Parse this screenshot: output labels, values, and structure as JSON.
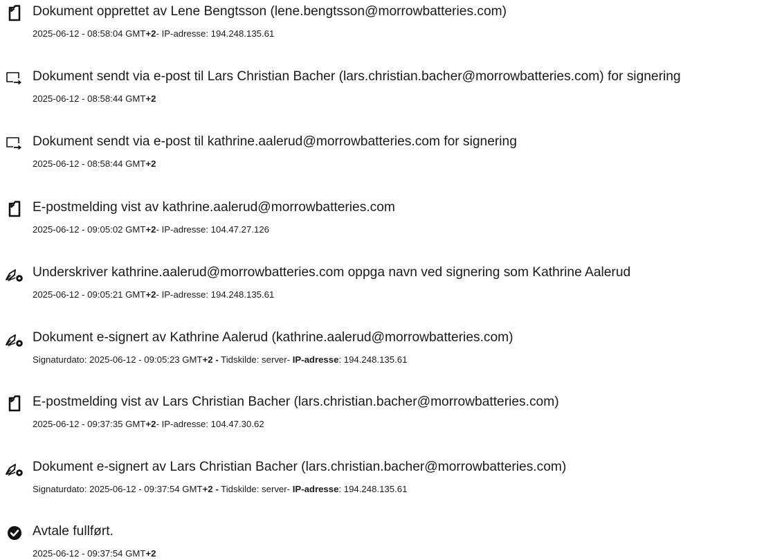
{
  "events": [
    {
      "icon": "document-icon",
      "title": "Dokument opprettet av Lene Bengtsson (lene.bengtsson@morrowbatteries.com)",
      "meta": "2025-06-12 - 08:58:04 GMT+2- IP-adresse: 194.248.135.61"
    },
    {
      "icon": "email-send-icon",
      "title": "Dokument sendt via e-post til Lars Christian Bacher (lars.christian.bacher@morrowbatteries.com) for signering",
      "meta": "2025-06-12 - 08:58:44 GMT+2"
    },
    {
      "icon": "email-send-icon",
      "title": "Dokument sendt via e-post til kathrine.aalerud@morrowbatteries.com for signering",
      "meta": "2025-06-12 - 08:58:44 GMT+2"
    },
    {
      "icon": "document-icon",
      "title": "E-postmelding vist av kathrine.aalerud@morrowbatteries.com",
      "meta": "2025-06-12 - 09:05:02 GMT+2- IP-adresse: 104.47.27.126"
    },
    {
      "icon": "signature-pen-icon",
      "title": "Underskriver kathrine.aalerud@morrowbatteries.com oppga navn ved signering som Kathrine Aalerud",
      "meta": "2025-06-12 - 09:05:21 GMT+2- IP-adresse: 194.248.135.61"
    },
    {
      "icon": "signature-pen-icon",
      "title": "Dokument e-signert av Kathrine Aalerud (kathrine.aalerud@morrowbatteries.com)",
      "meta": "Signaturdato: 2025-06-12 - 09:05:23 GMT+2 - Tidskilde: server- IP-adresse: 194.248.135.61"
    },
    {
      "icon": "document-icon",
      "title": "E-postmelding vist av Lars Christian Bacher (lars.christian.bacher@morrowbatteries.com)",
      "meta": "2025-06-12 - 09:37:35 GMT+2- IP-adresse: 104.47.30.62"
    },
    {
      "icon": "signature-pen-icon",
      "title": "Dokument e-signert av Lars Christian Bacher (lars.christian.bacher@morrowbatteries.com)",
      "meta": "Signaturdato: 2025-06-12 - 09:37:54 GMT+2 - Tidskilde: server- IP-adresse: 194.248.135.61"
    },
    {
      "icon": "checkmark-circle-icon",
      "title": "Avtale fullført.",
      "meta": "2025-06-12 - 09:37:54 GMT+2"
    }
  ]
}
